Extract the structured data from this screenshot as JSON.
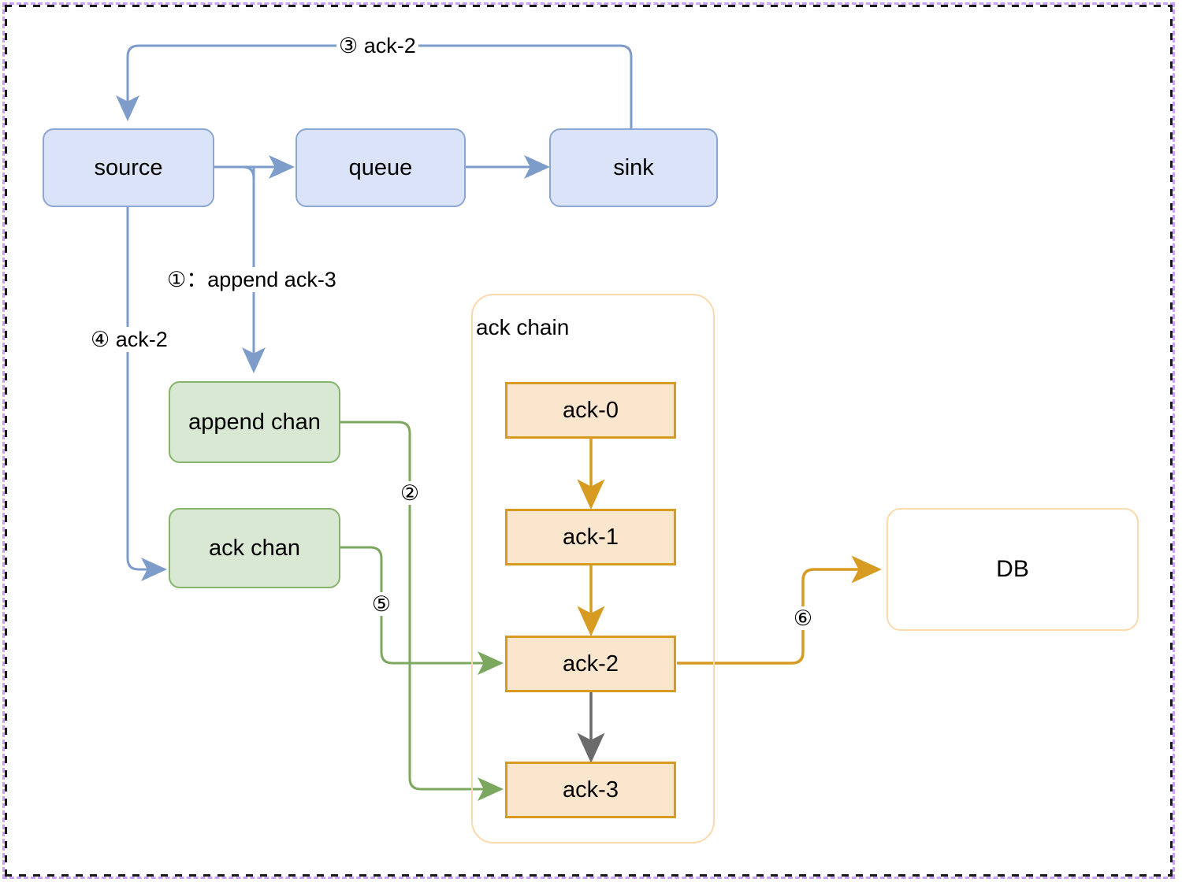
{
  "diagram": {
    "title": "ack chain flow diagram",
    "colors": {
      "blue_fill": "#dae3f7",
      "blue_stroke": "#8ba6d4",
      "green_fill": "#d9e8d2",
      "green_stroke": "#85b46a",
      "orange_fill": "#fae5cd",
      "orange_stroke": "#d69b20",
      "group_stroke": "#fbd9ac",
      "gray_stroke": "#666666",
      "selection_border": "#c9a0fa"
    },
    "nodes": {
      "source": "source",
      "queue": "queue",
      "sink": "sink",
      "append_chan": "append chan",
      "ack_chan": "ack chan",
      "ack_chain_group": "ack chain",
      "ack0": "ack-0",
      "ack1": "ack-1",
      "ack2": "ack-2",
      "ack3": "ack-3",
      "db": "DB"
    },
    "edge_labels": {
      "step1": "①：append ack-3",
      "step2": "②",
      "step3": "③ ack-2",
      "step4": "④ ack-2",
      "step5": "⑤",
      "step6": "⑥"
    }
  }
}
